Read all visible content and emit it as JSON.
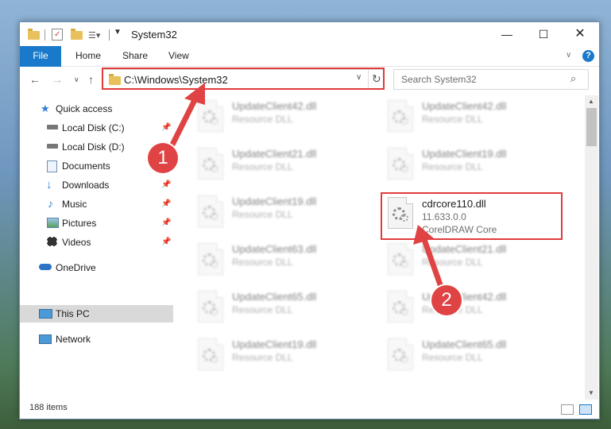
{
  "window": {
    "title": "System32"
  },
  "ribbon": {
    "tabs": [
      "File",
      "Home",
      "Share",
      "View"
    ]
  },
  "address": {
    "path": "C:\\Windows\\System32"
  },
  "search": {
    "placeholder": "Search System32"
  },
  "nav": {
    "items": [
      {
        "label": "Quick access",
        "icon": "star-icon"
      },
      {
        "label": "Local Disk (C:)",
        "icon": "drive-icon",
        "pinned": true
      },
      {
        "label": "Local Disk (D:)",
        "icon": "drive-icon"
      },
      {
        "label": "Documents",
        "icon": "documents-icon",
        "pinned": true
      },
      {
        "label": "Downloads",
        "icon": "download-icon",
        "pinned": true
      },
      {
        "label": "Music",
        "icon": "music-icon",
        "pinned": true
      },
      {
        "label": "Pictures",
        "icon": "pictures-icon",
        "pinned": true
      },
      {
        "label": "Videos",
        "icon": "videos-icon",
        "pinned": true
      },
      {
        "label": "OneDrive",
        "icon": "cloud-icon"
      },
      {
        "label": "This PC",
        "icon": "computer-icon",
        "selected": true
      },
      {
        "label": "Network",
        "icon": "network-icon"
      }
    ]
  },
  "files": [
    {
      "name": "UpdateClient42.dll",
      "desc": "Resource DLL",
      "blurred": true
    },
    {
      "name": "UpdateClient42.dll",
      "desc": "Resource DLL",
      "blurred": true
    },
    {
      "name": "UpdateClient21.dll",
      "desc": "Resource DLL",
      "blurred": true
    },
    {
      "name": "UpdateClient19.dll",
      "desc": "Resource DLL",
      "blurred": true
    },
    {
      "name": "UpdateClient19.dll",
      "desc": "Resource DLL",
      "blurred": true
    },
    {
      "name": "cdrcore110.dll",
      "desc": "11.633.0.0",
      "desc2": "CorelDRAW Core",
      "blurred": false
    },
    {
      "name": "UpdateClient63.dll",
      "desc": "Resource DLL",
      "blurred": true
    },
    {
      "name": "UpdateClient21.dll",
      "desc": "Resource DLL",
      "blurred": true
    },
    {
      "name": "UpdateClient65.dll",
      "desc": "Resource DLL",
      "blurred": true
    },
    {
      "name": "UpdateClient42.dll",
      "desc": "Resource DLL",
      "blurred": true
    },
    {
      "name": "UpdateClient19.dll",
      "desc": "Resource DLL",
      "blurred": true
    },
    {
      "name": "UpdateClient65.dll",
      "desc": "Resource DLL",
      "blurred": true
    }
  ],
  "status": {
    "count": "188 items"
  },
  "annotations": {
    "badge1": "1",
    "badge2": "2",
    "color": "#e04343"
  }
}
